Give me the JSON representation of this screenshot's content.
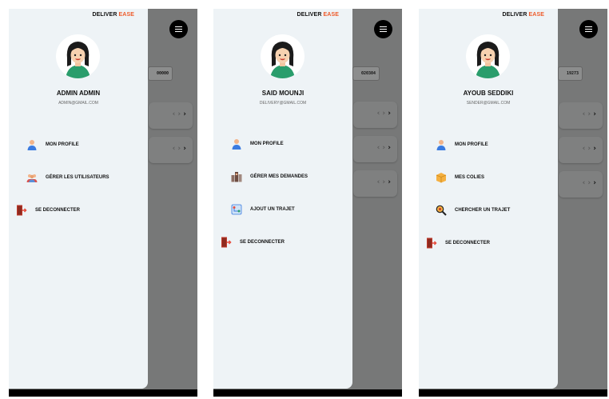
{
  "brand": {
    "part1": "DELIVER",
    "part2": "EASE"
  },
  "screens": [
    {
      "name": "ADMIN ADMIN",
      "email": "ADMIN@GMAIL.COM",
      "id_fragment": "00000",
      "menu": [
        {
          "label": "MON PROFILE",
          "icon": "user-icon"
        },
        {
          "label": "GÉRER LES UTILISATEURS",
          "icon": "users-group-icon"
        },
        {
          "label": "SE DECONNECTER",
          "icon": "logout-door-icon"
        }
      ]
    },
    {
      "name": "SAID MOUNJI",
      "email": "DELIVERY@GMAIL.COM",
      "id_fragment": "020304",
      "menu": [
        {
          "label": "MON PROFILE",
          "icon": "user-icon"
        },
        {
          "label": "GÉRER MES DEMANDES",
          "icon": "boxes-icon"
        },
        {
          "label": "AJOUT UN TRAJET",
          "icon": "route-icon"
        },
        {
          "label": "SE DECONNECTER",
          "icon": "logout-door-icon"
        }
      ]
    },
    {
      "name": "AYOUB SEDDIKI",
      "email": "SENDER@GMAIL.COM",
      "id_fragment": "19273",
      "menu": [
        {
          "label": "MON PROFILE",
          "icon": "user-icon"
        },
        {
          "label": "MES COLIES",
          "icon": "package-icon"
        },
        {
          "label": "CHERCHER UN TRAJET",
          "icon": "search-magnifier-icon"
        },
        {
          "label": "SE DECONNECTER",
          "icon": "logout-door-icon"
        }
      ]
    }
  ],
  "colors": {
    "brand_accent": "#ee5a2a",
    "drawer_bg": "#eef3f6",
    "overlay_bg": "#777878"
  }
}
